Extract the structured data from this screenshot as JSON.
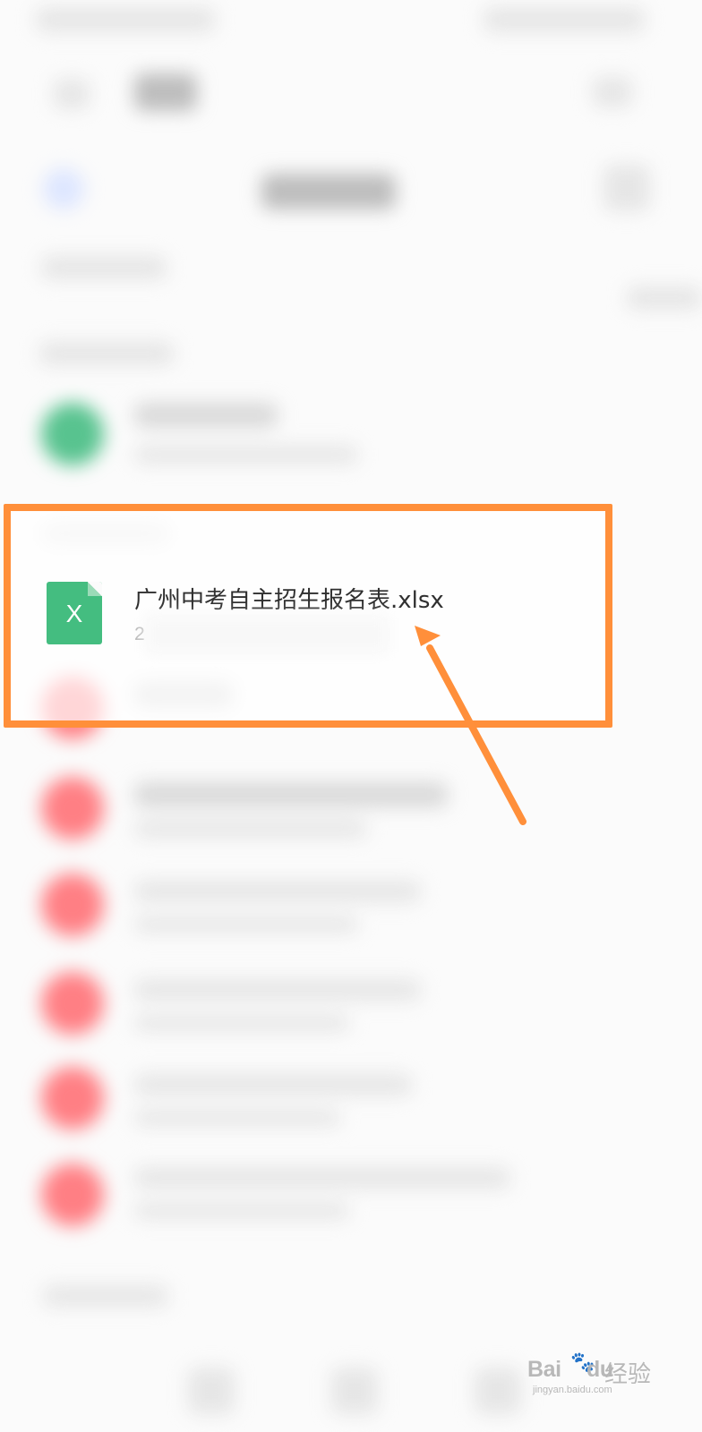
{
  "file_list": {
    "highlighted_item": {
      "icon_letter": "X",
      "file_name": "广州中考自主招生报名表.xlsx",
      "meta": "2"
    }
  },
  "watermark": {
    "brand": "Bai",
    "brand_suffix": "du",
    "paw": "🐾",
    "experience": "经验",
    "url": "jingyan.baidu.com"
  },
  "colors": {
    "highlight": "#ff8f3a",
    "excel_green": "#44bd80",
    "pdf_red": "#ff7f84"
  },
  "icons": {
    "file_icon": "excel-file-icon",
    "annotation_arrow": "arrow-icon"
  }
}
